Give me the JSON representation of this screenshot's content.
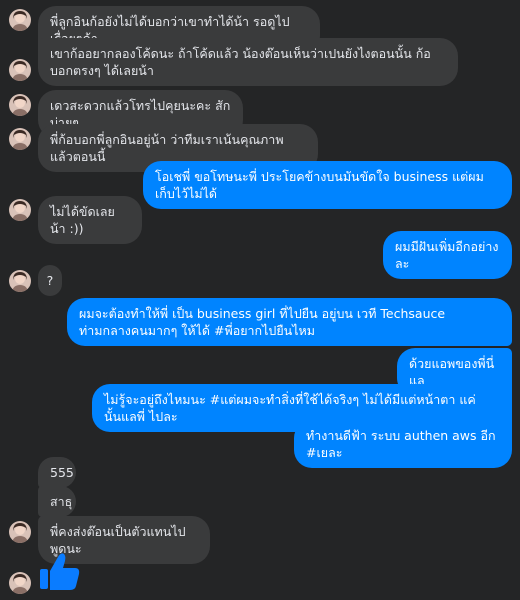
{
  "colors": {
    "background": "#242526",
    "incoming_bubble": "#3a3b3c",
    "outgoing_bubble": "#0084ff",
    "text": "#e4e6eb"
  },
  "messages": [
    {
      "side": "in",
      "text": "พี่ลูกอินก้อยังไม่ได้บอกว่าเขาทำได้น้า รอดูไปเรื่อยๆค้า"
    },
    {
      "side": "in",
      "text": "เขาก้ออยากลองโค้ดนะ ถ้าโค้ดแล้ว น้องต๊อนเห็นว่าเปนยังไงตอนนั้น ก้อบอกตรงๆ ได้เลยน้า"
    },
    {
      "side": "in",
      "text": "เดวสะดวกแล้วโทรไปคุยนะคะ สักบ่ายๆ"
    },
    {
      "side": "in",
      "text": "พี่ก้อบอกพี่ลูกอินอยู่น้า ว่าทีมเราเน้นคุณภาพแล้วตอนนี้"
    },
    {
      "side": "out",
      "text": "โอเชพี่ ขอโทษนะพี่ ประโยคข้างบนมันขัดใจ business แต่ผมเก็บไว้ไม่ได้"
    },
    {
      "side": "in",
      "text": "ไม่ได้ขัดเลยน้า :))"
    },
    {
      "side": "out",
      "text": "ผมมีฝันเพิ่มอีกอย่างละ"
    },
    {
      "side": "in",
      "text": "?"
    },
    {
      "side": "out",
      "text": "ผมจะต้องทำให้พี่ เป็น business girl ที่ไปยืน อยู่บน เวที Techsauce ท่ามกลางคนมากๆ ให้ได้ #พี่อยากไปยืนไหม"
    },
    {
      "side": "out",
      "text": "ด้วยแอพของพี่นี่แล"
    },
    {
      "side": "out",
      "text": "ไม่รู้จะอยู่ถึงไหมนะ #แต่ผมจะทำสิ่งที่ใช้ได้จริงๆ ไม่ได้มีแต่หน้าตา แค่นั้นแลพี่ ไปละ"
    },
    {
      "side": "out",
      "text": "ทำงานดีฟ้า ระบบ authen aws อีก #เยละ"
    },
    {
      "side": "in",
      "text": "555"
    },
    {
      "side": "in",
      "text": "สาธุ"
    },
    {
      "side": "in",
      "text": "พี่คงส่งต๊อนเป็นตัวแทนไปพูดนะ"
    }
  ],
  "icons": {
    "avatar": "avatar-icon",
    "like": "thumbs-up-icon"
  }
}
